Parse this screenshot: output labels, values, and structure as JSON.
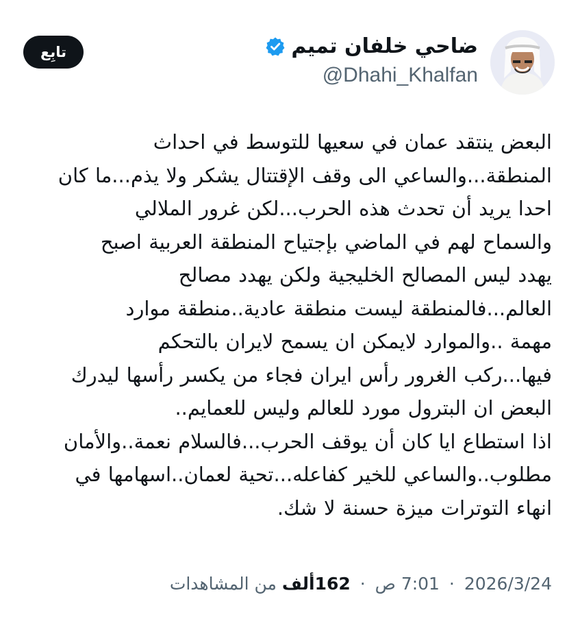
{
  "author": {
    "display_name": "ضاحي خلفان تميم",
    "handle": "@Dhahi_Khalfan",
    "verified_icon": "verified-badge-icon",
    "avatar_icon": "profile-photo"
  },
  "follow_button": {
    "label": "تابِع"
  },
  "tweet": {
    "lines": [
      "البعض ينتقد عمان في سعيها للتوسط في احداث",
      "المنطقة...والساعي الى وقف الإقتتال يشكر ولا يذم...ما كان",
      "احدا يريد أن تحدث هذه الحرب...لكن غرور الملالي",
      "والسماح لهم في الماضي بإجتياح المنطقة العربية اصبح",
      "يهدد ليس المصالح الخليجية ولكن يهدد مصالح",
      "العالم...فالمنطقة ليست منطقة عادية..منطقة موارد",
      "مهمة ..والموارد لايمكن ان يسمح لايران بالتحكم",
      "فيها...ركب الغرور رأس ايران فجاء من يكسر رأسها ليدرك",
      "البعض ان البترول مورد للعالم وليس للعمايم..",
      "اذا استطاع ايا كان أن يوقف الحرب...فالسلام نعمة..والأمان",
      "مطلوب..والساعي للخير كفاعله...تحية لعمان..اسهامها في",
      "انهاء التوترات ميزة حسنة لا شك."
    ]
  },
  "meta": {
    "time": "7:01 ص",
    "date": "2026/3/24",
    "views_count": "162ألف",
    "views_label": "من المشاهدات",
    "separator": "·"
  },
  "colors": {
    "text": "#0f1419",
    "secondary": "#536471",
    "verified": "#1d9bf0",
    "button_bg": "#0f1419",
    "button_text": "#ffffff"
  }
}
